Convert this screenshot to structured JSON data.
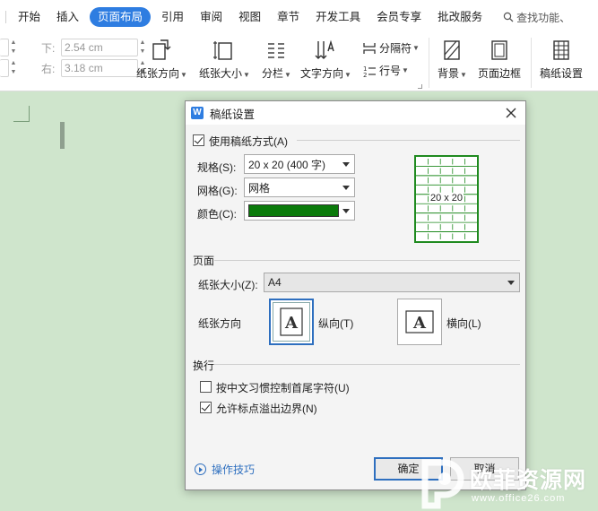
{
  "menu": {
    "items": [
      "开始",
      "插入",
      "页面布局",
      "引用",
      "审阅",
      "视图",
      "章节",
      "开发工具",
      "会员专享",
      "批改服务"
    ],
    "active_index": 2,
    "search": "查找功能、"
  },
  "ribbon": {
    "margin_bottom_label": "下:",
    "margin_bottom_value": "2.54 cm",
    "margin_right_label": "右:",
    "margin_right_value": "3.18 cm",
    "paper_orientation": "纸张方向",
    "paper_size": "纸张大小",
    "columns": "分栏",
    "text_direction": "文字方向",
    "separator": "分隔符",
    "line_number": "行号",
    "background": "背景",
    "page_border": "页面边框",
    "grid_paper": "稿纸设置"
  },
  "dialog": {
    "title": "稿纸设置",
    "use_grid_label": "使用稿纸方式(A)",
    "use_grid_checked": true,
    "spec_label": "规格(S):",
    "spec_value": "20 x 20 (400 字)",
    "grid_label": "网格(G):",
    "grid_value": "网格",
    "color_label": "颜色(C):",
    "color_value": "#0a7a0a",
    "preview_text": "20 x 20",
    "page_section": "页面",
    "paper_size_label": "纸张大小(Z):",
    "paper_size_value": "A4",
    "orientation_label": "纸张方向",
    "portrait_label": "纵向(T)",
    "landscape_label": "横向(L)",
    "orientation_glyph": "A",
    "selected_orientation": "portrait",
    "wrap_section": "换行",
    "option_chinese_label": "按中文习惯控制首尾字符(U)",
    "option_chinese_checked": false,
    "option_punct_label": "允许标点溢出边界(N)",
    "option_punct_checked": true,
    "tips_label": "操作技巧",
    "ok_label": "确定",
    "cancel_label": "取消"
  },
  "watermark": {
    "text": "欧菲资源网",
    "url": "www.office26.com"
  },
  "colors": {
    "accent": "#2e7de1",
    "document_bg": "#cfe5cc",
    "grid_green": "#1f8a1f"
  }
}
